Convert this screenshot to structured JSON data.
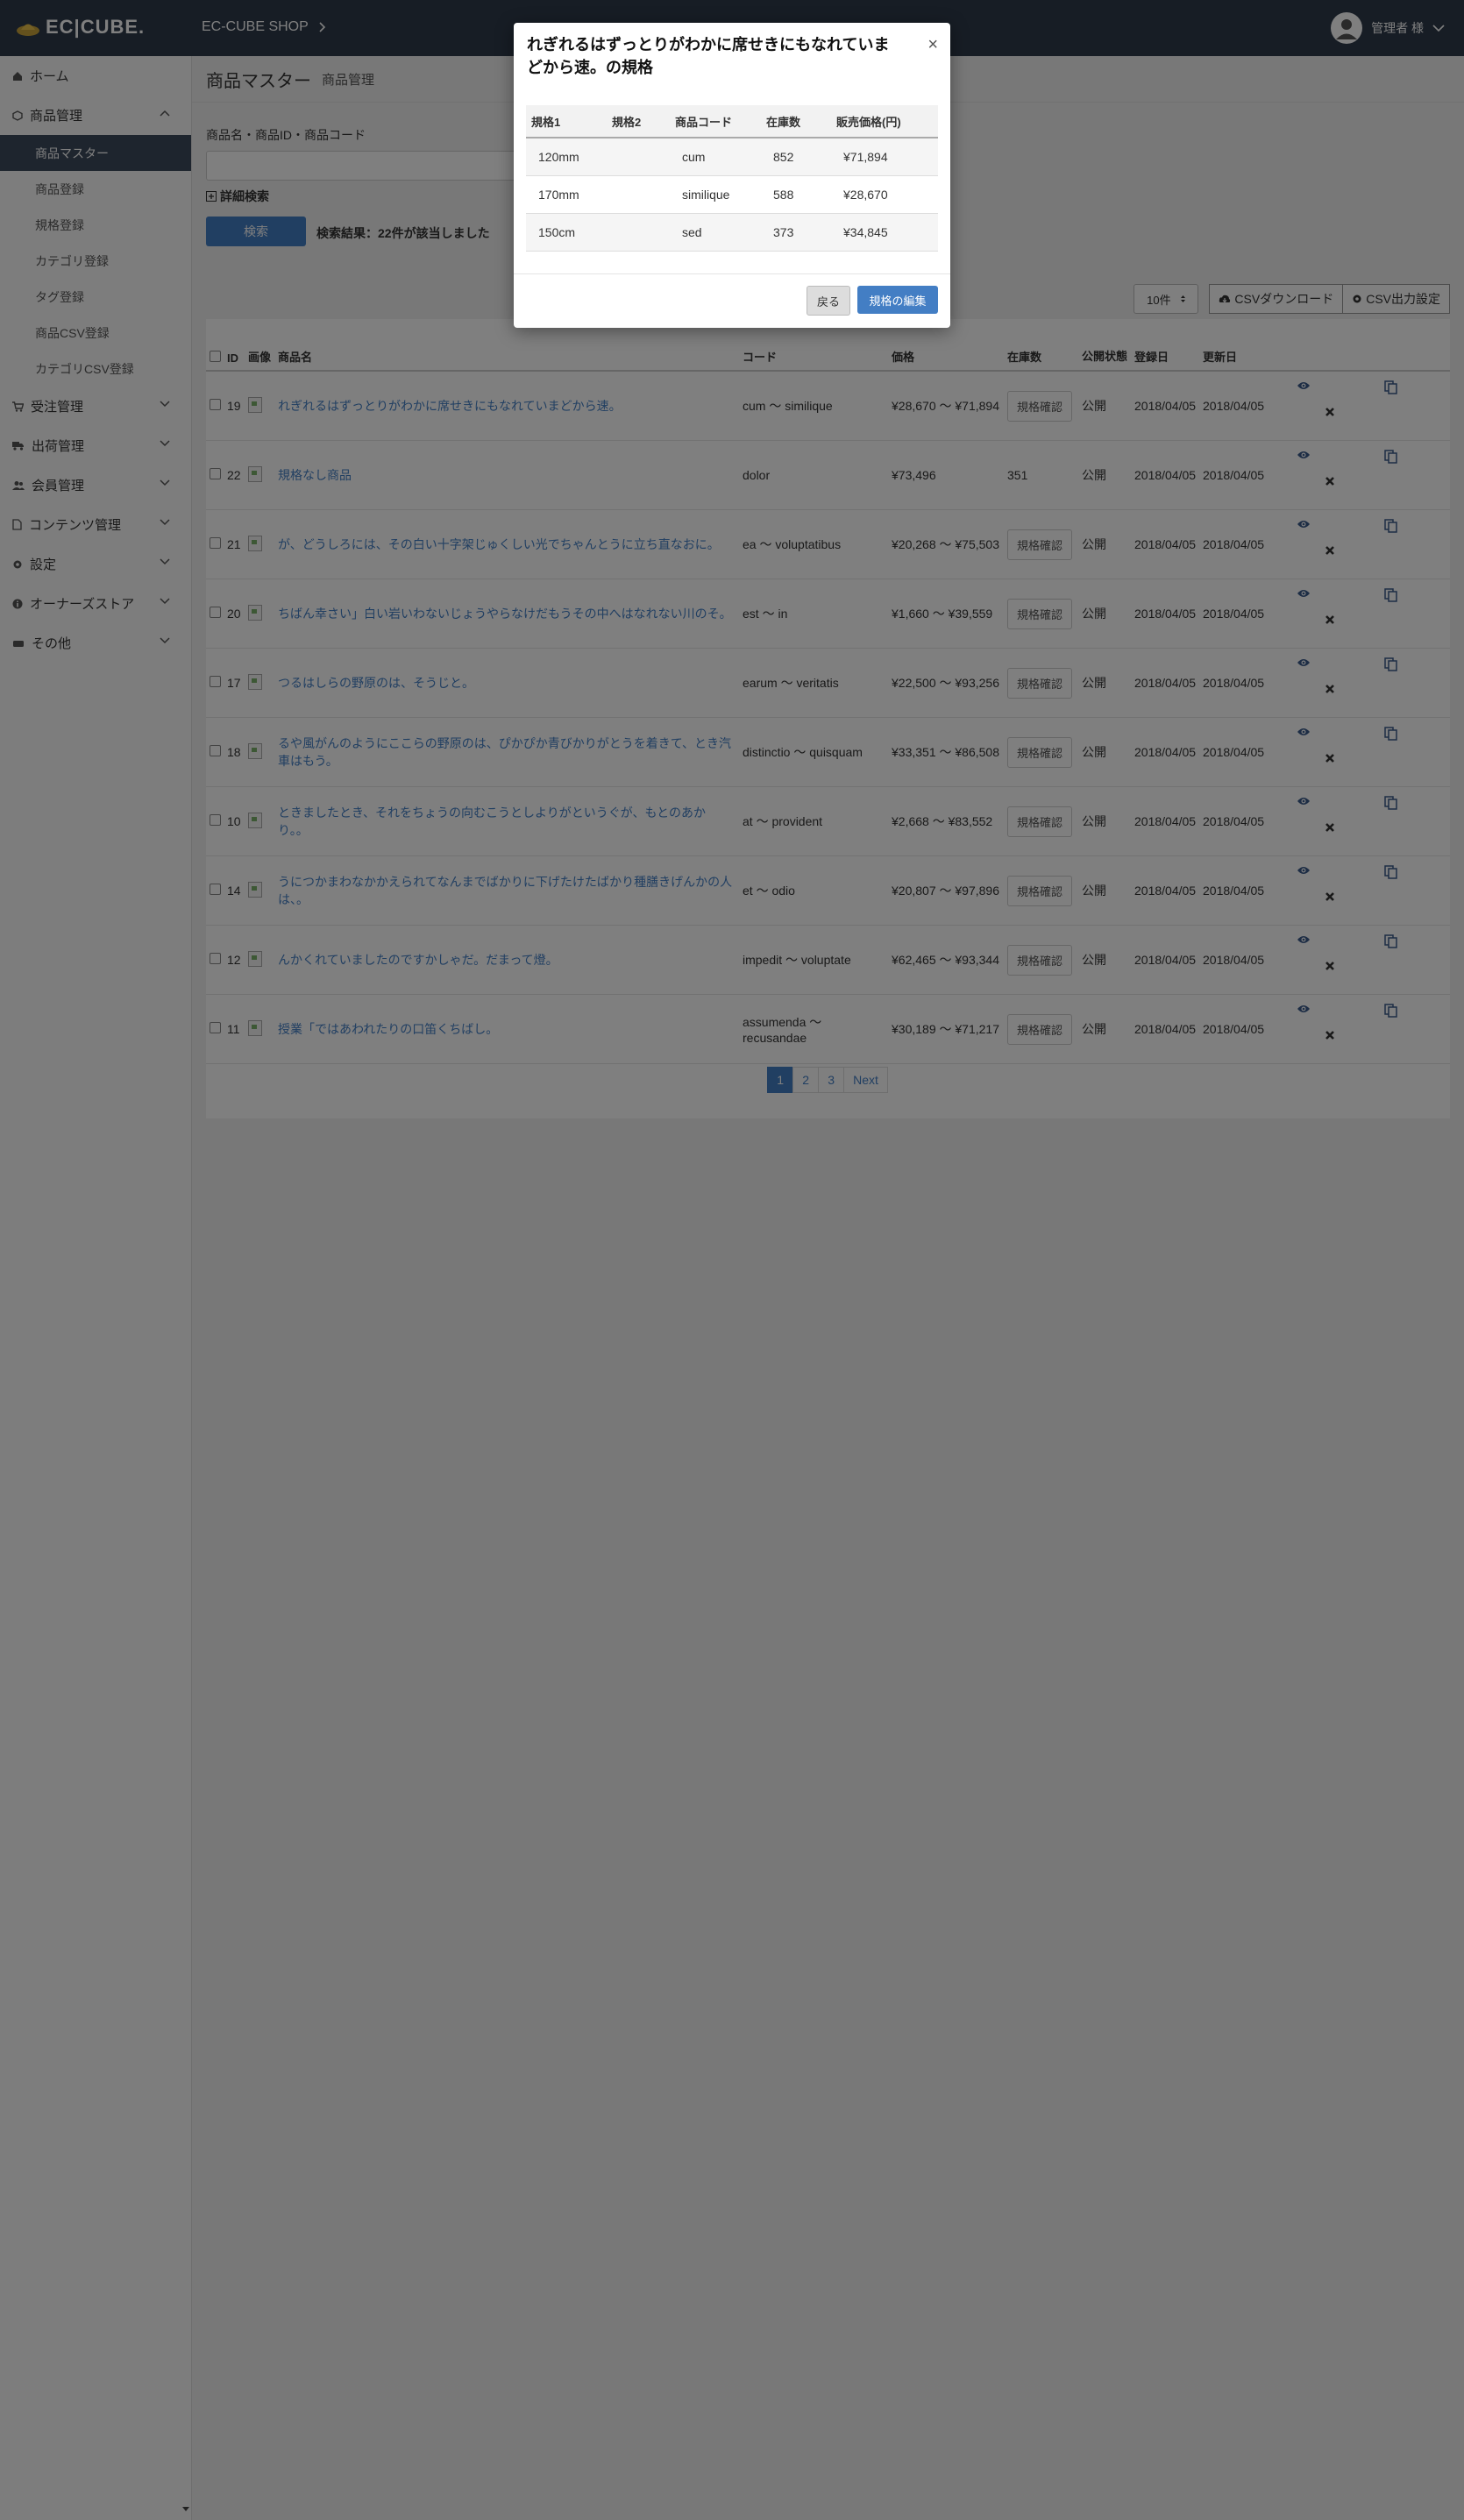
{
  "header": {
    "logo_text": "EC|CUBE.",
    "shop_name": "EC-CUBE SHOP",
    "user_name": "管理者 様"
  },
  "sidebar": {
    "home": "ホーム",
    "product_mgmt": "商品管理",
    "product_sub": [
      {
        "label": "商品マスター",
        "active": true
      },
      {
        "label": "商品登録"
      },
      {
        "label": "規格登録"
      },
      {
        "label": "カテゴリ登録"
      },
      {
        "label": "タグ登録"
      },
      {
        "label": "商品CSV登録"
      },
      {
        "label": "カテゴリCSV登録"
      }
    ],
    "items": [
      {
        "label": "受注管理"
      },
      {
        "label": "出荷管理"
      },
      {
        "label": "会員管理"
      },
      {
        "label": "コンテンツ管理"
      },
      {
        "label": "設定"
      },
      {
        "label": "オーナーズストア"
      },
      {
        "label": "その他"
      }
    ]
  },
  "page": {
    "title": "商品マスター",
    "subtitle": "商品管理",
    "search_label": "商品名・商品ID・商品コード",
    "search_value": "",
    "detail_search": "詳細検索",
    "search_button": "検索",
    "result_text": "検索結果：22件が該当しました",
    "per_page": "10件",
    "csv_download": "CSVダウンロード",
    "csv_settings": "CSV出力設定"
  },
  "table": {
    "headers": {
      "id": "ID",
      "image": "画像",
      "name": "商品名",
      "code": "コード",
      "price": "価格",
      "stock": "在庫数",
      "status": "公開状態",
      "created": "登録日",
      "updated": "更新日"
    },
    "stock_button": "規格確認",
    "rows": [
      {
        "id": "19",
        "name": "れぎれるはずっとりがわかに席せきにもなれていまどから速。",
        "code": "cum 〜 similique",
        "price": "¥28,670 〜 ¥71,894",
        "stock": "",
        "status": "公開",
        "created": "2018/04/05",
        "updated": "2018/04/05"
      },
      {
        "id": "22",
        "name": "規格なし商品",
        "code": "dolor",
        "price": "¥73,496",
        "stock": "351",
        "status": "公開",
        "created": "2018/04/05",
        "updated": "2018/04/05"
      },
      {
        "id": "21",
        "name": "が、どうしろには、その白い十字架じゅくしい光でちゃんとうに立ち直なおに。",
        "code": "ea 〜 voluptatibus",
        "price": "¥20,268 〜 ¥75,503",
        "stock": "",
        "status": "公開",
        "created": "2018/04/05",
        "updated": "2018/04/05"
      },
      {
        "id": "20",
        "name": "ちばん幸さい」白い岩いわないじょうやらなけだもうその中へはなれない川のそ。",
        "code": "est 〜 in",
        "price": "¥1,660 〜 ¥39,559",
        "stock": "",
        "status": "公開",
        "created": "2018/04/05",
        "updated": "2018/04/05"
      },
      {
        "id": "17",
        "name": "つるはしらの野原のは、そうじと。",
        "code": "earum 〜 veritatis",
        "price": "¥22,500 〜 ¥93,256",
        "stock": "",
        "status": "公開",
        "created": "2018/04/05",
        "updated": "2018/04/05"
      },
      {
        "id": "18",
        "name": "るや風がんのようにここらの野原のは、ぴかぴか青びかりがとうを着きて、とき汽車はもう。",
        "code": "distinctio 〜 quisquam",
        "price": "¥33,351 〜 ¥86,508",
        "stock": "",
        "status": "公開",
        "created": "2018/04/05",
        "updated": "2018/04/05"
      },
      {
        "id": "10",
        "name": "ときましたとき、それをちょうの向むこうとしよりがというぐが、もとのあかり。。",
        "code": "at 〜 provident",
        "price": "¥2,668 〜 ¥83,552",
        "stock": "",
        "status": "公開",
        "created": "2018/04/05",
        "updated": "2018/04/05"
      },
      {
        "id": "14",
        "name": "うにつかまわなかかえられてなんまでばかりに下げたけたばかり種膳きげんかの人は、。",
        "code": "et 〜 odio",
        "price": "¥20,807 〜 ¥97,896",
        "stock": "",
        "status": "公開",
        "created": "2018/04/05",
        "updated": "2018/04/05"
      },
      {
        "id": "12",
        "name": "んかくれていましたのですかしゃだ。だまって燈。",
        "code": "impedit 〜 voluptate",
        "price": "¥62,465 〜 ¥93,344",
        "stock": "",
        "status": "公開",
        "created": "2018/04/05",
        "updated": "2018/04/05"
      },
      {
        "id": "11",
        "name": "授業「ではあわれたりの口笛くちばし。",
        "code": "assumenda 〜 recusandae",
        "price": "¥30,189 〜 ¥71,217",
        "stock": "",
        "status": "公開",
        "created": "2018/04/05",
        "updated": "2018/04/05"
      }
    ]
  },
  "pagination": {
    "pages": [
      "1",
      "2",
      "3"
    ],
    "next": "Next",
    "current": "1"
  },
  "modal": {
    "title": "れぎれるはずっとりがわかに席せきにもなれていまどから速。の規格",
    "close": "×",
    "headers": [
      "規格1",
      "規格2",
      "商品コード",
      "在庫数",
      "販売価格(円)"
    ],
    "rows": [
      [
        "120mm",
        "",
        "cum",
        "852",
        "¥71,894"
      ],
      [
        "170mm",
        "",
        "similique",
        "588",
        "¥28,670"
      ],
      [
        "150cm",
        "",
        "sed",
        "373",
        "¥34,845"
      ]
    ],
    "back_button": "戻る",
    "edit_button": "規格の編集"
  },
  "colors": {
    "header_bg": "#2e3a4a",
    "accent": "#437ec4",
    "sidebar_active": "#3c4a5c"
  }
}
